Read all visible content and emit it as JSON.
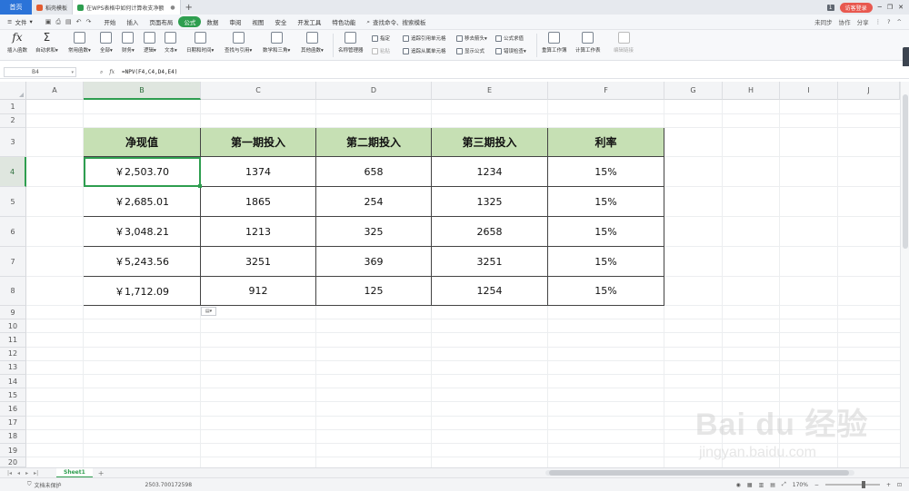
{
  "tabbar": {
    "home": "首页",
    "tabs": [
      {
        "label": "稻壳模板",
        "color": "#e35b2f"
      },
      {
        "label": "在WPS表格中如何计算收支净额",
        "color": "#2e9e4f",
        "active": true
      }
    ],
    "add": "+",
    "badge": "1",
    "login": "访客登录"
  },
  "menubar": {
    "file": "文件",
    "items": [
      "开始",
      "插入",
      "页面布局",
      "公式",
      "数据",
      "审阅",
      "视图",
      "安全",
      "开发工具",
      "特色功能"
    ],
    "active_item": "公式",
    "search": "查找命令、搜索模板",
    "right": [
      "未同步",
      "协作",
      "分享"
    ]
  },
  "ribbon": {
    "big": [
      "插入函数",
      "自动求和▾",
      "常用函数▾",
      "全部▾",
      "财务▾",
      "逻辑▾",
      "文本▾",
      "日期和时间▾",
      "查找与引用▾",
      "数学和三角▾",
      "其他函数▾",
      "名称管理器"
    ],
    "small": [
      [
        "指定",
        "粘贴"
      ],
      [
        "追踪引用单元格",
        "追踪从属单元格"
      ],
      [
        "移去箭头▾",
        "显示公式"
      ],
      [
        "公式求值",
        "错误检查▾"
      ]
    ],
    "calc": [
      "重算工作簿",
      "计算工作表",
      "编辑链接"
    ]
  },
  "formula_bar": {
    "name_box": "B4",
    "formula": "=NPV(F4,C4,D4,E4)"
  },
  "grid": {
    "columns": [
      "A",
      "B",
      "C",
      "D",
      "E",
      "F",
      "G",
      "H",
      "I",
      "J"
    ],
    "rows": [
      "1",
      "2",
      "3",
      "4",
      "5",
      "6",
      "7",
      "8",
      "9",
      "10",
      "11",
      "12",
      "13",
      "14",
      "15",
      "16",
      "17",
      "18",
      "19",
      "20"
    ],
    "selected_column": "B",
    "selected_row": "4"
  },
  "table": {
    "headers": [
      "净现值",
      "第一期投入",
      "第二期投入",
      "第三期投入",
      "利率"
    ],
    "header_bg": "#c6e0b4",
    "rows": [
      [
        "￥2,503.70",
        "1374",
        "658",
        "1234",
        "15%"
      ],
      [
        "￥2,685.01",
        "1865",
        "254",
        "1325",
        "15%"
      ],
      [
        "￥3,048.21",
        "1213",
        "325",
        "2658",
        "15%"
      ],
      [
        "￥5,243.56",
        "3251",
        "369",
        "3251",
        "15%"
      ],
      [
        "￥1,712.09",
        "912",
        "125",
        "1254",
        "15%"
      ]
    ]
  },
  "sheets": {
    "tabs": [
      "Sheet1"
    ],
    "add": "+"
  },
  "status": {
    "protection": "文档未保护",
    "value": "2503.700172598",
    "zoom": "170%"
  },
  "watermark": {
    "logo": "Bai du 经验",
    "url": "jingyan.baidu.com"
  },
  "accent": "#2e9e4f"
}
